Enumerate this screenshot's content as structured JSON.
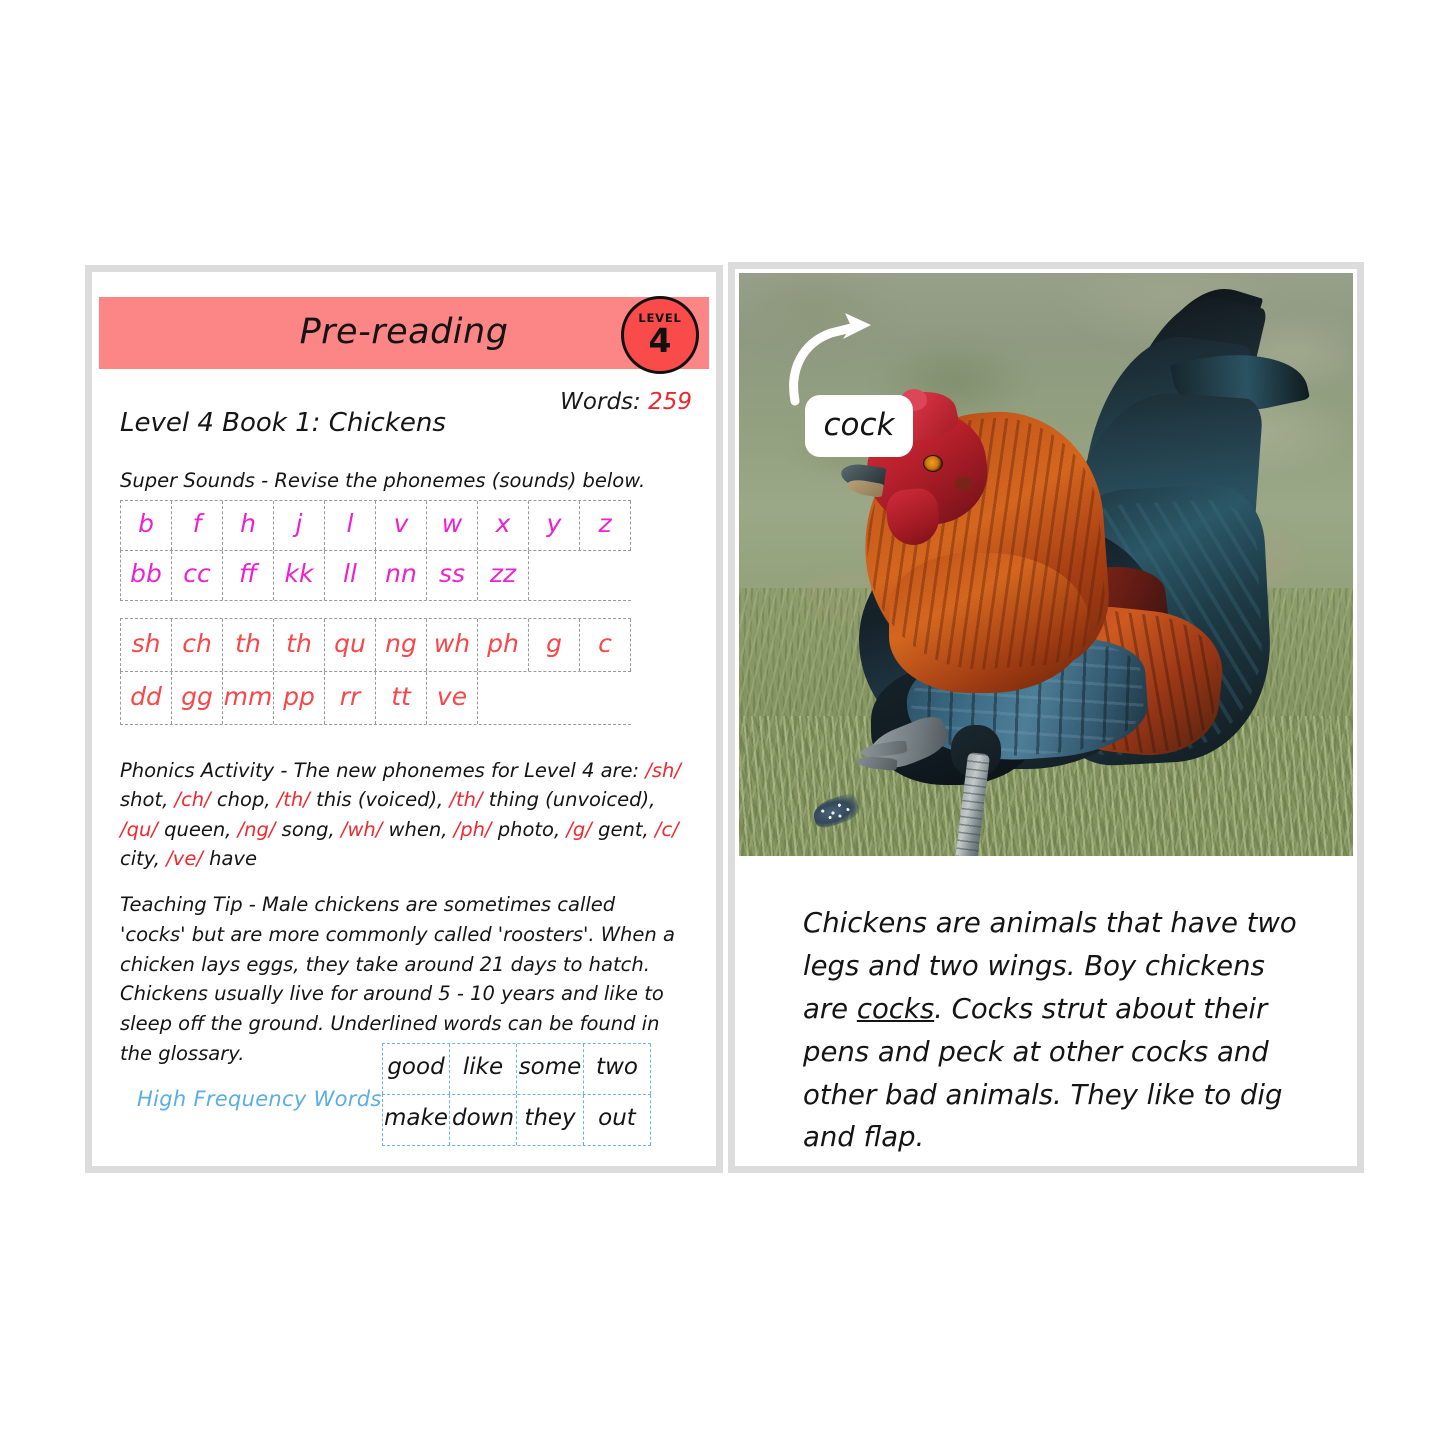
{
  "left_page": {
    "header": {
      "title": "Pre-reading",
      "band_color": "#fc8585"
    },
    "level_badge": {
      "word": "LEVEL",
      "number": "4",
      "fill_color": "#fa4b4b"
    },
    "words": {
      "label": "Words:",
      "count": "259",
      "count_color": "#e8292f"
    },
    "book_line": "Level 4 Book 1: Chickens",
    "super_sounds": {
      "label": "Super Sounds - Revise the phonemes (sounds) below.",
      "grid_a_color": "#ec21cf",
      "grid_b_color": "#f6474a",
      "grid_a": [
        [
          "b",
          "f",
          "h",
          "j",
          "l",
          "v",
          "w",
          "x",
          "y",
          "z"
        ],
        [
          "bb",
          "cc",
          "ff",
          "kk",
          "ll",
          "nn",
          "ss",
          "zz"
        ]
      ],
      "grid_b": [
        [
          "sh",
          "ch",
          "th",
          "th",
          "qu",
          "ng",
          "wh",
          "ph",
          "g",
          "c"
        ],
        [
          "dd",
          "gg",
          "mm",
          "pp",
          "rr",
          "tt",
          "ve"
        ]
      ]
    },
    "phonics_activity": {
      "intro": "Phonics Activity - The new phonemes for Level 4 are: ",
      "items": [
        {
          "phoneme": "/sh/",
          "word": "shot,"
        },
        {
          "phoneme": "/ch/",
          "word": "chop,"
        },
        {
          "phoneme": "/th/",
          "word": "this (voiced),"
        },
        {
          "phoneme": "/th/",
          "word": "thing (unvoiced),"
        },
        {
          "phoneme": "/qu/",
          "word": "queen,"
        },
        {
          "phoneme": "/ng/",
          "word": "song,"
        },
        {
          "phoneme": "/wh/",
          "word": "when,"
        },
        {
          "phoneme": "/ph/",
          "word": "photo,"
        },
        {
          "phoneme": "/g/",
          "word": "gent,"
        },
        {
          "phoneme": "/c/",
          "word": "city,"
        },
        {
          "phoneme": "/ve/",
          "word": "have"
        }
      ],
      "phoneme_color": "#ef2a32"
    },
    "teaching_tip": "Teaching Tip - Male chickens are sometimes called 'cocks' but are more commonly called 'roosters'. When a chicken lays eggs, they take around 21 days to hatch. Chickens usually live for around 5 - 10 years and like to sleep off the ground. Underlined words can be found in the glossary.",
    "high_frequency": {
      "label": "High Frequency Words",
      "label_color": "#5aaee6",
      "rows": [
        [
          "good",
          "like",
          "some",
          "two"
        ],
        [
          "make",
          "down",
          "they",
          "out"
        ]
      ]
    }
  },
  "right_page": {
    "photo": {
      "subject": "rooster walking on grass",
      "callout_label": "cock"
    },
    "body_text": {
      "before_underline": "Chickens are animals that have two legs and two wings. Boy chickens are ",
      "underlined": "cocks",
      "after_underline": ". Cocks strut about their pens and peck at other cocks and other bad animals. They like to dig and flap."
    }
  }
}
